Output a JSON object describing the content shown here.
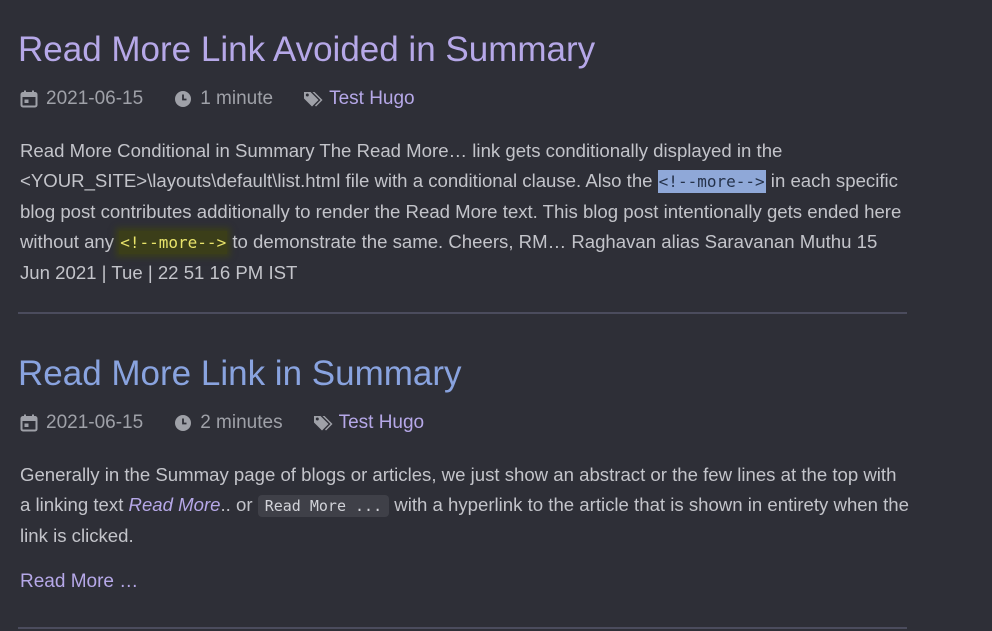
{
  "posts": [
    {
      "title": "Read More Link Avoided in Summary",
      "date": "2021-06-15",
      "read_time": "1 minute",
      "tag": "Test Hugo",
      "summary": {
        "p1": "Read More Conditional in Summary The Read More… link gets conditionally displayed in the <YOUR_SITE>\\layouts\\default\\list.html file with a conditional clause. Also the ",
        "code1": "<!--more-->",
        "p2": " in each specific blog post contributes additionally to render the Read More text. This blog post intentionally gets ended here without any ",
        "code2": "<!--more-->",
        "p3": " to demonstrate the same. Cheers, RM… Raghavan alias Saravanan Muthu 15 Jun 2021 | Tue | 22 51 16 PM IST"
      }
    },
    {
      "title": "Read More Link in Summary",
      "date": "2021-06-15",
      "read_time": "2 minutes",
      "tag": "Test Hugo",
      "summary": {
        "p1": "Generally in the Summay page of blogs or articles, we just show an abstract or the few lines at the top with a linking text ",
        "em": "Read More",
        "p2": ".. or ",
        "code": "Read More ...",
        "p3": " with a hyperlink to the article that is shown in entirety when the link is clicked."
      },
      "read_more": "Read More …"
    }
  ],
  "icons": [
    "calendar-icon",
    "clock-icon",
    "tag-icon"
  ],
  "colors": {
    "background": "#2e2f37",
    "title_visited": "#b6a8e8",
    "title_link": "#89a3df",
    "selection_highlight": "#8fa8d8",
    "search_highlight": "#3b3e19"
  }
}
